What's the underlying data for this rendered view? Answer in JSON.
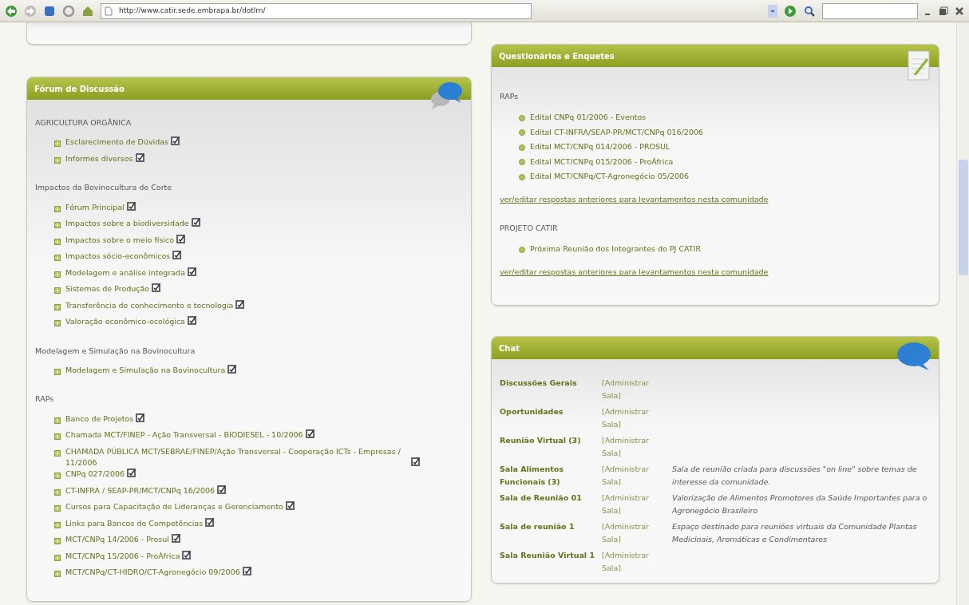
{
  "browser": {
    "url": "http://www.catir.sede.embrapa.br/dotlrn/"
  },
  "forum": {
    "title": "Fórum de Discussão",
    "groups": [
      {
        "name": "AGRICULTURA ORGÂNICA",
        "items": [
          "Esclarecimento de Dúvidas",
          "Informes diversos"
        ]
      },
      {
        "name": "Impactos da Bovinocultura de Corte",
        "items": [
          "Fórum Principal",
          "Impactos sobre a biodiversidade",
          "Impactos sobre o meio físico",
          "Impactos sócio-econômicos",
          "Modelagem e análise integrada",
          "Sistemas de Produção",
          "Transferência de conhecimento e tecnologia",
          "Valoração econômico-ecológica"
        ]
      },
      {
        "name": "Modelagem e Simulação na Bovinocultura",
        "items": [
          "Modelagem e Simulação na Bovinocultura"
        ]
      },
      {
        "name": "RAPs",
        "items": [
          "Banco de Projetos",
          "Chamada MCT/FINEP - Ação Transversal - BIODIESEL - 10/2006",
          "CHAMADA PÚBLICA MCT/SEBRAE/FINEP/Ação Transversal - Cooperação ICTs - Empresas / 11/2006",
          "CNPq 027/2006",
          "CT-INFRA / SEAP-PR/MCT/CNPq 16/2006",
          "Cursos para Capacitação de Lideranças e Gerenciamento",
          "Links para Bancos de Competências",
          "MCT/CNPq 14/2006 - Prosul",
          "MCT/CNPq 15/2006 - ProÁfrica",
          "MCT/CNPq/CT-HIDRO/CT-Agronegócio 09/2006"
        ]
      }
    ]
  },
  "surveys": {
    "title": "Questionários e Enquetes",
    "groups": [
      {
        "name": "RAPs",
        "items": [
          "Edital CNPq 01/2006 - Eventos",
          "Edital CT-INFRA/SEAP-PR/MCT/CNPq 016/2006",
          "Edital MCT/CNPq 014/2006 - PROSUL",
          "Edital MCT/CNPq 015/2006 - ProÁfrica",
          "Edital MCT/CNPq/CT-Agronegócio 05/2006"
        ],
        "link": "ver/editar respostas anteriores para levantamentos nesta comunidade"
      },
      {
        "name": "PROJETO CATIR",
        "items": [
          "Próxima Reunião dos Integrantes do PJ CATIR"
        ],
        "link": "ver/editar respostas anteriores para levantamentos nesta comunidade"
      }
    ]
  },
  "chat": {
    "title": "Chat",
    "rooms": [
      {
        "name": "Discussões Gerais",
        "action": "[Administrar Sala]"
      },
      {
        "name": "Oportunidades",
        "action": "[Administrar Sala]"
      },
      {
        "name": "Reunião Virtual (3)",
        "action": "[Administrar Sala]"
      },
      {
        "name": "Sala Alimentos Funcionais (3)",
        "action": "[Administrar Sala]",
        "description": "Sala de reunião criada para discussões \"on line\" sobre temas de interesse da comunidade."
      },
      {
        "name": "Sala de Reunião 01",
        "action": "[Administrar Sala]",
        "description": "Valorização de Alimentos Promotores da Saúde Importantes para o Agronegócio Brasileiro"
      },
      {
        "name": "Sala de reunião 1",
        "action": "[Administrar Sala]",
        "description": "Espaço destinado para reuniões virtuais da Comunidade Plantas Medicinais, Aromáticas e Condimentares"
      },
      {
        "name": "Sala Reunião Virtual 1",
        "action": "[Administrar Sala]"
      }
    ]
  }
}
